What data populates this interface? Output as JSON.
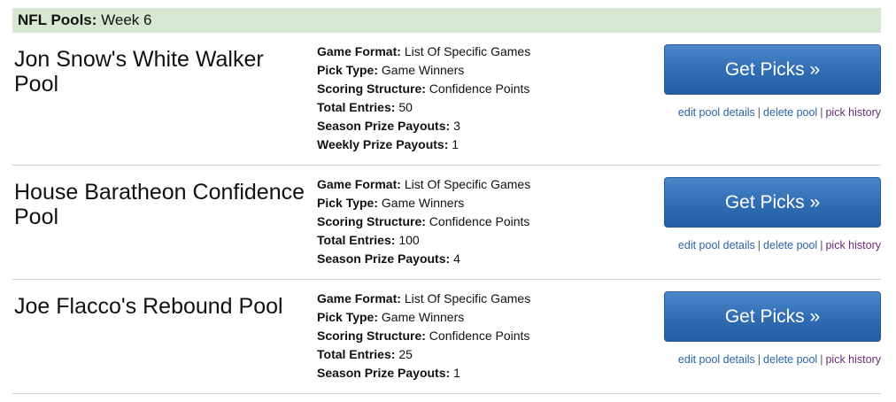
{
  "header": {
    "label": "NFL Pools:",
    "week": "Week 6"
  },
  "labels": {
    "game_format": "Game Format:",
    "pick_type": "Pick Type:",
    "scoring_structure": "Scoring Structure:",
    "total_entries": "Total Entries:",
    "season_prize_payouts": "Season Prize Payouts:",
    "weekly_prize_payouts": "Weekly Prize Payouts:"
  },
  "actions": {
    "get_picks": "Get Picks »",
    "edit_pool_details": "edit pool details",
    "delete_pool": "delete pool",
    "pick_history": "pick history",
    "separator": "|"
  },
  "pools": [
    {
      "name": "Jon Snow's White Walker Pool",
      "game_format": "List Of Specific Games",
      "pick_type": "Game Winners",
      "scoring_structure": "Confidence Points",
      "total_entries": "50",
      "season_prize_payouts": "3",
      "weekly_prize_payouts": "1"
    },
    {
      "name": "House Baratheon Confidence Pool",
      "game_format": "List Of Specific Games",
      "pick_type": "Game Winners",
      "scoring_structure": "Confidence Points",
      "total_entries": "100",
      "season_prize_payouts": "4"
    },
    {
      "name": "Joe Flacco's Rebound Pool",
      "game_format": "List Of Specific Games",
      "pick_type": "Game Winners",
      "scoring_structure": "Confidence Points",
      "total_entries": "25",
      "season_prize_payouts": "1"
    }
  ]
}
